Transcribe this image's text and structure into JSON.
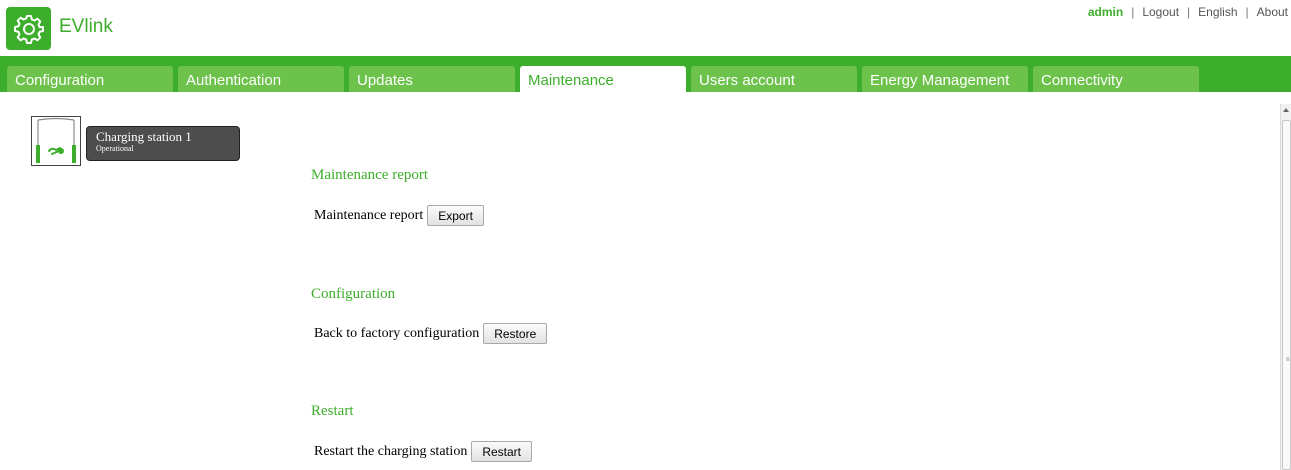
{
  "app": {
    "brand": "EVlink",
    "logo_icon": "gear-icon",
    "accent_color": "#3dae2b"
  },
  "top_links": {
    "user": "admin",
    "logout": "Logout",
    "language": "English",
    "about": "About"
  },
  "tabs": [
    {
      "label": "Configuration",
      "active": false
    },
    {
      "label": "Authentication",
      "active": false
    },
    {
      "label": "Updates",
      "active": false
    },
    {
      "label": "Maintenance",
      "active": true
    },
    {
      "label": "Users account",
      "active": false
    },
    {
      "label": "Energy Management",
      "active": false
    },
    {
      "label": "Connectivity",
      "active": false
    }
  ],
  "station": {
    "icon": "charging-station-icon",
    "name": "Charging station 1",
    "status": "Operational"
  },
  "sections": {
    "maintenance_report": {
      "title": "Maintenance report",
      "label": "Maintenance report",
      "button": "Export"
    },
    "configuration": {
      "title": "Configuration",
      "label": "Back to factory configuration",
      "button": "Restore"
    },
    "restart": {
      "title": "Restart",
      "label": "Restart the charging station",
      "button": "Restart"
    }
  }
}
